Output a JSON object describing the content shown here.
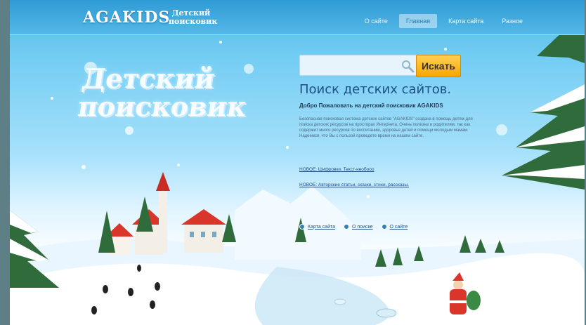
{
  "header": {
    "logo": "AGAKIDS",
    "logo_sub_line1": "Детский",
    "logo_sub_line2": "поисковик",
    "nav": [
      {
        "label": "О сайте",
        "active": false
      },
      {
        "label": "Главная",
        "active": true
      },
      {
        "label": "Карта сайта",
        "active": false
      },
      {
        "label": "Разное",
        "active": false
      }
    ]
  },
  "hero": {
    "title_line1": "Детский",
    "title_line2": "поисковик"
  },
  "search": {
    "placeholder": "",
    "button_label": "Искать"
  },
  "content": {
    "heading": "Поиск детских сайтов.",
    "welcome": "Добро Пожаловать на детский поисковик AGAKIDS",
    "paragraph": "Безопасная поисковая система детских сайтов \"AGAKIDS\" создана в помощь детям для поиска детских ресурсов на просторах Интернета. Очень полезна и родителям, так как содержит много ресурсов по воспитанию, здоровья детей и помощи молодым мамам. Надеемся, что Вы с пользой проведете время на нашем сайте.",
    "news1": "НОВОЕ: Шифровки. Текст-необооо",
    "news2": "НОВОЕ: Авторские статьи, сказки, стихи, рассказы."
  },
  "footer_links": [
    {
      "label": "Карта сайта"
    },
    {
      "label": "О поиске"
    },
    {
      "label": "О сайте"
    }
  ],
  "colors": {
    "accent": "#f7a600",
    "heading": "#1d4f80",
    "sky_top": "#4fb7e8"
  },
  "icons": {
    "search": "magnifier-icon"
  }
}
